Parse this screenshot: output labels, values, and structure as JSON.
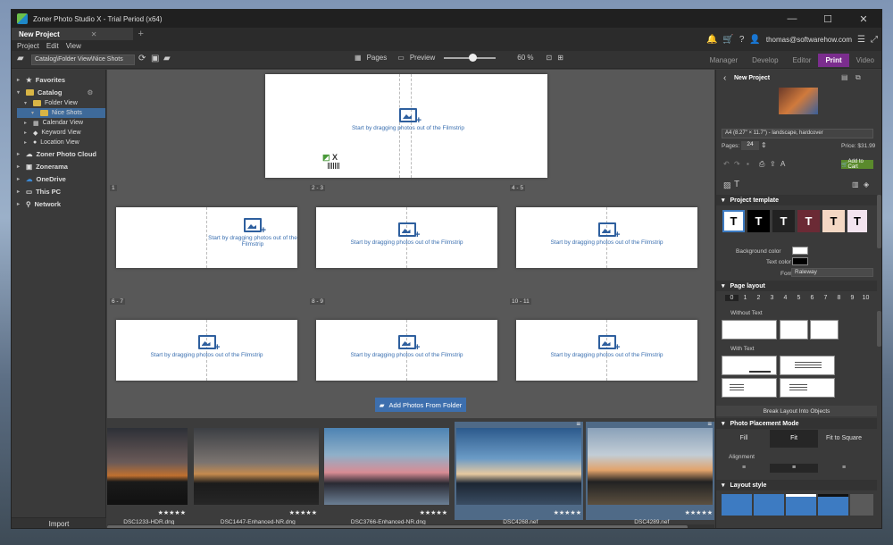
{
  "window": {
    "title": "Zoner Photo Studio X - Trial Period (x64)"
  },
  "tabs": [
    {
      "label": "New Project"
    }
  ],
  "menu": [
    "Project",
    "Edit",
    "View"
  ],
  "account": {
    "email": "thomas@softwarehow.com"
  },
  "path": "Catalog\\Folder View\\Nice Shots",
  "view": {
    "pages_label": "Pages",
    "preview_label": "Preview",
    "zoom": "60 %"
  },
  "modes": [
    "Manager",
    "Develop",
    "Editor",
    "Print",
    "Video"
  ],
  "active_mode": "Print",
  "nav": {
    "favorites": "Favorites",
    "catalog": "Catalog",
    "folder_view": "Folder View",
    "nice_shots": "Nice Shots",
    "calendar_view": "Calendar View",
    "keyword_view": "Keyword View",
    "location_view": "Location View",
    "zoner_cloud": "Zoner Photo Cloud",
    "zonerama": "Zonerama",
    "onedrive": "OneDrive",
    "this_pc": "This PC",
    "network": "Network",
    "import": "Import"
  },
  "canvas": {
    "placeholder": "Start by dragging photos out of the Filmstrip",
    "page_labels": [
      "1",
      "2 - 3",
      "4 - 5",
      "6 - 7",
      "8 - 9",
      "10 - 11"
    ],
    "cover_logo_text": "X",
    "add_button": "Add Photos From Folder"
  },
  "filmstrip": [
    {
      "name": "_DSC1233-HDR.dng",
      "stars": "★★★★★"
    },
    {
      "name": "_DSC1447-Enhanced-NR.dng",
      "stars": "★★★★★"
    },
    {
      "name": "_DSC3766-Enhanced-NR.dng",
      "stars": "★★★★★"
    },
    {
      "name": "_DSC4268.nef",
      "stars": "★★★★★"
    },
    {
      "name": "_DSC4289.nef",
      "stars": "★★★★★"
    }
  ],
  "right_panel": {
    "project_name": "New Project",
    "format": "A4 (8.27\" × 11.7\") - landscape, hardcover",
    "pages_label": "Pages:",
    "pages_value": "24",
    "price": "Price: $31.99",
    "add_to_cart": "Add to Cart",
    "project_template": "Project template",
    "background_color_label": "Background color",
    "text_color_label": "Text color",
    "font_label": "Font",
    "font_value": "Raleway",
    "page_layout": "Page layout",
    "layout_numbers": [
      "0",
      "1",
      "2",
      "3",
      "4",
      "5",
      "6",
      "7",
      "8",
      "9",
      "10"
    ],
    "without_text": "Without Text",
    "with_text": "With Text",
    "break_layout": "Break Layout Into Objects",
    "photo_placement_mode": "Photo Placement Mode",
    "placement_fill": "Fill",
    "placement_fit": "Fit",
    "placement_fit_square": "Fit to Square",
    "alignment": "Alignment",
    "layout_style": "Layout style",
    "template_glyph": "T"
  },
  "colors": {
    "accent_print": "#7b2d8e",
    "selection": "#3e6a9a",
    "button": "#3d6fae",
    "cart": "#5a8a2c"
  }
}
